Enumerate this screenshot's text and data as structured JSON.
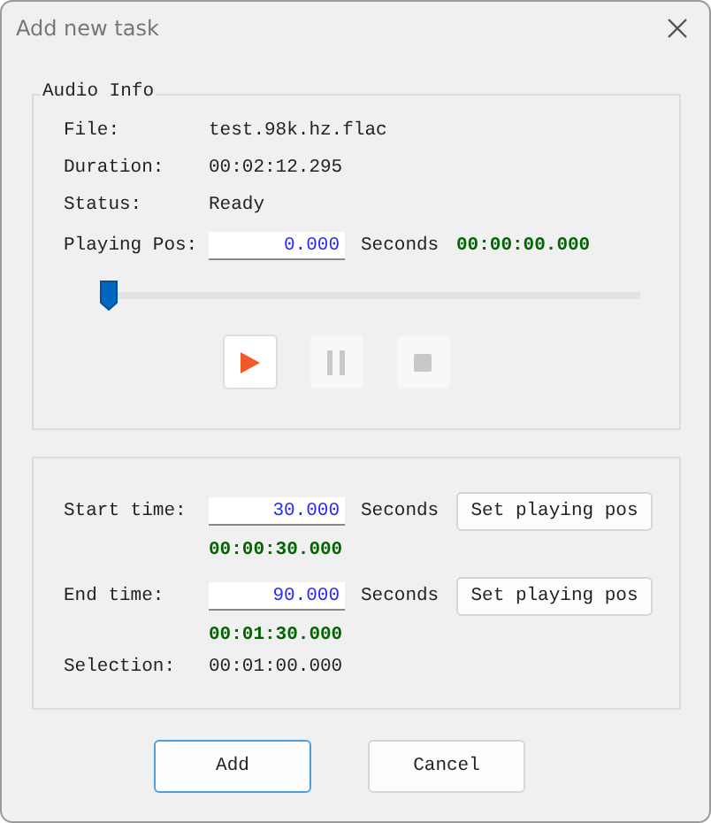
{
  "window": {
    "title": "Add new task"
  },
  "audio_info": {
    "title": "Audio Info",
    "rows": [
      {
        "label": "File:",
        "value": "test.98k.hz.flac"
      },
      {
        "label": "Duration:",
        "value": "00:02:12.295"
      },
      {
        "label": "Status:",
        "value": "Ready"
      }
    ],
    "playing_pos": {
      "label": "Playing Pos:",
      "value": "0.000",
      "unit": "Seconds",
      "time": "00:00:00.000"
    },
    "slider": {
      "level": 0
    },
    "transport": [
      {
        "kind": "play",
        "disabled": false
      },
      {
        "kind": "pause",
        "disabled": true
      },
      {
        "kind": "stop",
        "disabled": true
      }
    ]
  },
  "range": {
    "times": [
      {
        "label": "Start time:",
        "value": "30.000",
        "unit": "Seconds",
        "button": "Set playing pos",
        "time": "00:00:30.000"
      },
      {
        "label": "End time:",
        "value": "90.000",
        "unit": "Seconds",
        "button": "Set playing pos",
        "time": "00:01:30.000"
      }
    ],
    "selection": {
      "label": "Selection:",
      "value": "00:01:00.000"
    }
  },
  "buttons": [
    {
      "label": "Add",
      "default": true
    },
    {
      "label": "Cancel",
      "default": false
    }
  ]
}
